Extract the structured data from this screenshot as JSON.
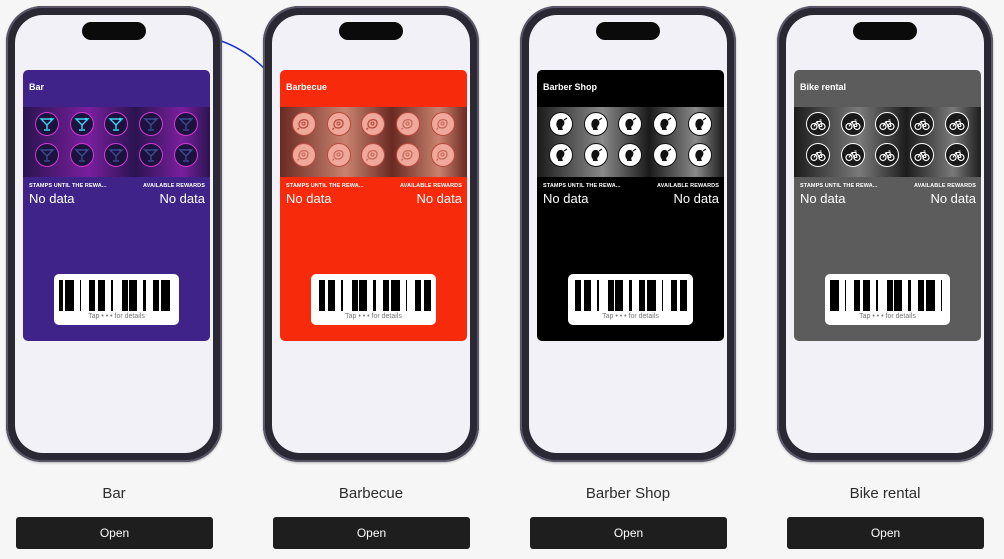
{
  "cards": [
    {
      "id": "bar",
      "pass_title": "Bar",
      "caption": "Bar",
      "button_label": "Open",
      "stamps_label": "STAMPS UNTIL THE REWA...",
      "stamps_value": "No data",
      "rewards_label": "AVAILABLE REWARDS",
      "rewards_value": "No data",
      "tap_hint": "Tap • • • for details",
      "stamp_icon": "cocktail-icon",
      "colors": {
        "pass_bg": "#3f2388",
        "strip_a": "#2a1450",
        "strip_b": "#7a1f9e",
        "stamp_ring": "#d03bd0",
        "stamp_fill": "#1c1240",
        "stamp_fg_active": "#3fd4f0",
        "stamp_fg": "#3a4a8a"
      }
    },
    {
      "id": "barbecue",
      "pass_title": "Barbecue",
      "caption": "Barbecue",
      "button_label": "Open",
      "stamps_label": "STAMPS UNTIL THE REWA...",
      "stamps_value": "No data",
      "rewards_label": "AVAILABLE REWARDS",
      "rewards_value": "No data",
      "tap_hint": "Tap • • • for details",
      "stamp_icon": "meat-icon",
      "colors": {
        "pass_bg": "#f72a0c",
        "strip_a": "#6a2a22",
        "strip_b": "#c9826e",
        "stamp_ring": "#b74a3c",
        "stamp_fill": "#f0a89a",
        "stamp_fg_active": "#b74a3c",
        "stamp_fg": "#c76a5c"
      }
    },
    {
      "id": "barber-shop",
      "pass_title": "Barber Shop",
      "caption": "Barber Shop",
      "button_label": "Open",
      "stamps_label": "STAMPS UNTIL THE REWA...",
      "stamps_value": "No data",
      "rewards_label": "AVAILABLE REWARDS",
      "rewards_value": "No data",
      "tap_hint": "Tap • • • for details",
      "stamp_icon": "barber-head-icon",
      "colors": {
        "pass_bg": "#000000",
        "strip_a": "#1a1a1a",
        "strip_b": "#8a8a8a",
        "stamp_ring": "#111111",
        "stamp_fill": "#ffffff",
        "stamp_fg_active": "#111111",
        "stamp_fg": "#111111"
      }
    },
    {
      "id": "bike-rental",
      "pass_title": "Bike rental",
      "caption": "Bike rental",
      "button_label": "Open",
      "stamps_label": "STAMPS UNTIL THE REWA...",
      "stamps_value": "No data",
      "rewards_label": "AVAILABLE REWARDS",
      "rewards_value": "No data",
      "tap_hint": "Tap • • • for details",
      "stamp_icon": "bicycle-icon",
      "colors": {
        "pass_bg": "#5c5c5c",
        "strip_a": "#1c1c1c",
        "strip_b": "#7a7a7a",
        "stamp_ring": "#ffffff",
        "stamp_fill": "#1a1a1a",
        "stamp_fg_active": "#ffffff",
        "stamp_fg": "#ffffff"
      }
    }
  ]
}
